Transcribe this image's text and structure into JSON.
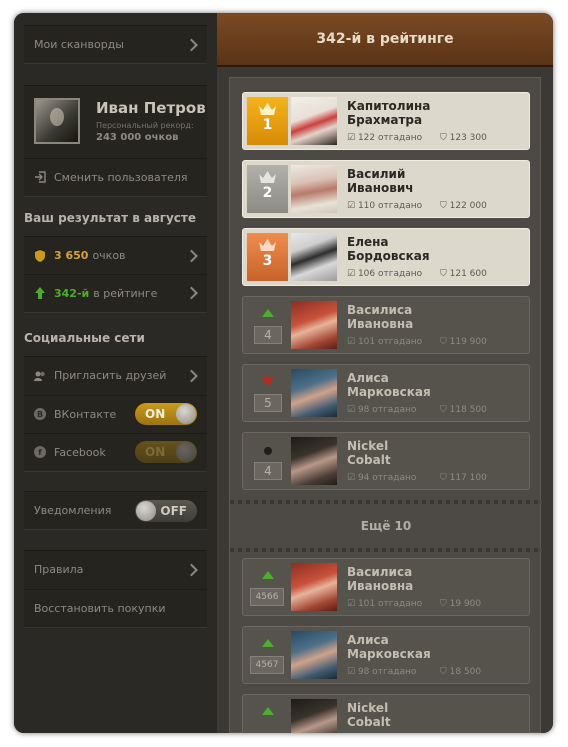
{
  "sidebar": {
    "my_crosswords": "Мои сканворды",
    "user": {
      "name": "Иван Петров",
      "record_label": "Персональный рекорд:",
      "record_value": "243 000 очков"
    },
    "switch_user": "Сменить пользователя",
    "result_title": "Ваш результат в августе",
    "points": {
      "value": "3 650",
      "suffix": "очков"
    },
    "rank": {
      "value": "342-й",
      "suffix": "в рейтинге"
    },
    "social_title": "Социальные сети",
    "invite_friends": "Пригласить друзей",
    "vk": {
      "label": "ВКонтакте",
      "toggle": "ON",
      "badge": "B"
    },
    "facebook": {
      "label": "Facebook",
      "toggle": "ON",
      "badge": "f"
    },
    "notifications": {
      "label": "Уведомления",
      "toggle": "OFF"
    },
    "rules": "Правила",
    "restore": "Восстановить покупки"
  },
  "main": {
    "title": "342-й в рейтинге",
    "show_more": "Ещё 10",
    "players": [
      {
        "rank": "1",
        "name1": "Капитолина",
        "name2": "Брахматра",
        "guessed": "122 отгадано",
        "points": "123 300"
      },
      {
        "rank": "2",
        "name1": "Василий",
        "name2": "Иванович",
        "guessed": "110 отгадано",
        "points": "122 000"
      },
      {
        "rank": "3",
        "name1": "Елена",
        "name2": "Бордовская",
        "guessed": "106 отгадано",
        "points": "121 600"
      },
      {
        "rank": "4",
        "name1": "Василиса",
        "name2": "Ивановна",
        "guessed": "101 отгадано",
        "points": "119 900"
      },
      {
        "rank": "5",
        "name1": "Алиса",
        "name2": "Марковская",
        "guessed": "98 отгадано",
        "points": "118 500"
      },
      {
        "rank": "4",
        "name1": "Nickel",
        "name2": "Cobalt",
        "guessed": "94 отгадано",
        "points": "117 100"
      }
    ],
    "players_more": [
      {
        "rank": "4566",
        "name1": "Василиса",
        "name2": "Ивановна",
        "guessed": "101 отгадано",
        "points": "19 900"
      },
      {
        "rank": "4567",
        "name1": "Алиса",
        "name2": "Марковская",
        "guessed": "98 отгадано",
        "points": "18 500"
      },
      {
        "rank": "",
        "name1": "Nickel",
        "name2": "Cobalt"
      }
    ]
  },
  "colors": {
    "gold": "#e09a10",
    "silver": "#9c9a94",
    "bronze": "#dc7840",
    "green": "#4cae2c",
    "red": "#c0241a"
  }
}
